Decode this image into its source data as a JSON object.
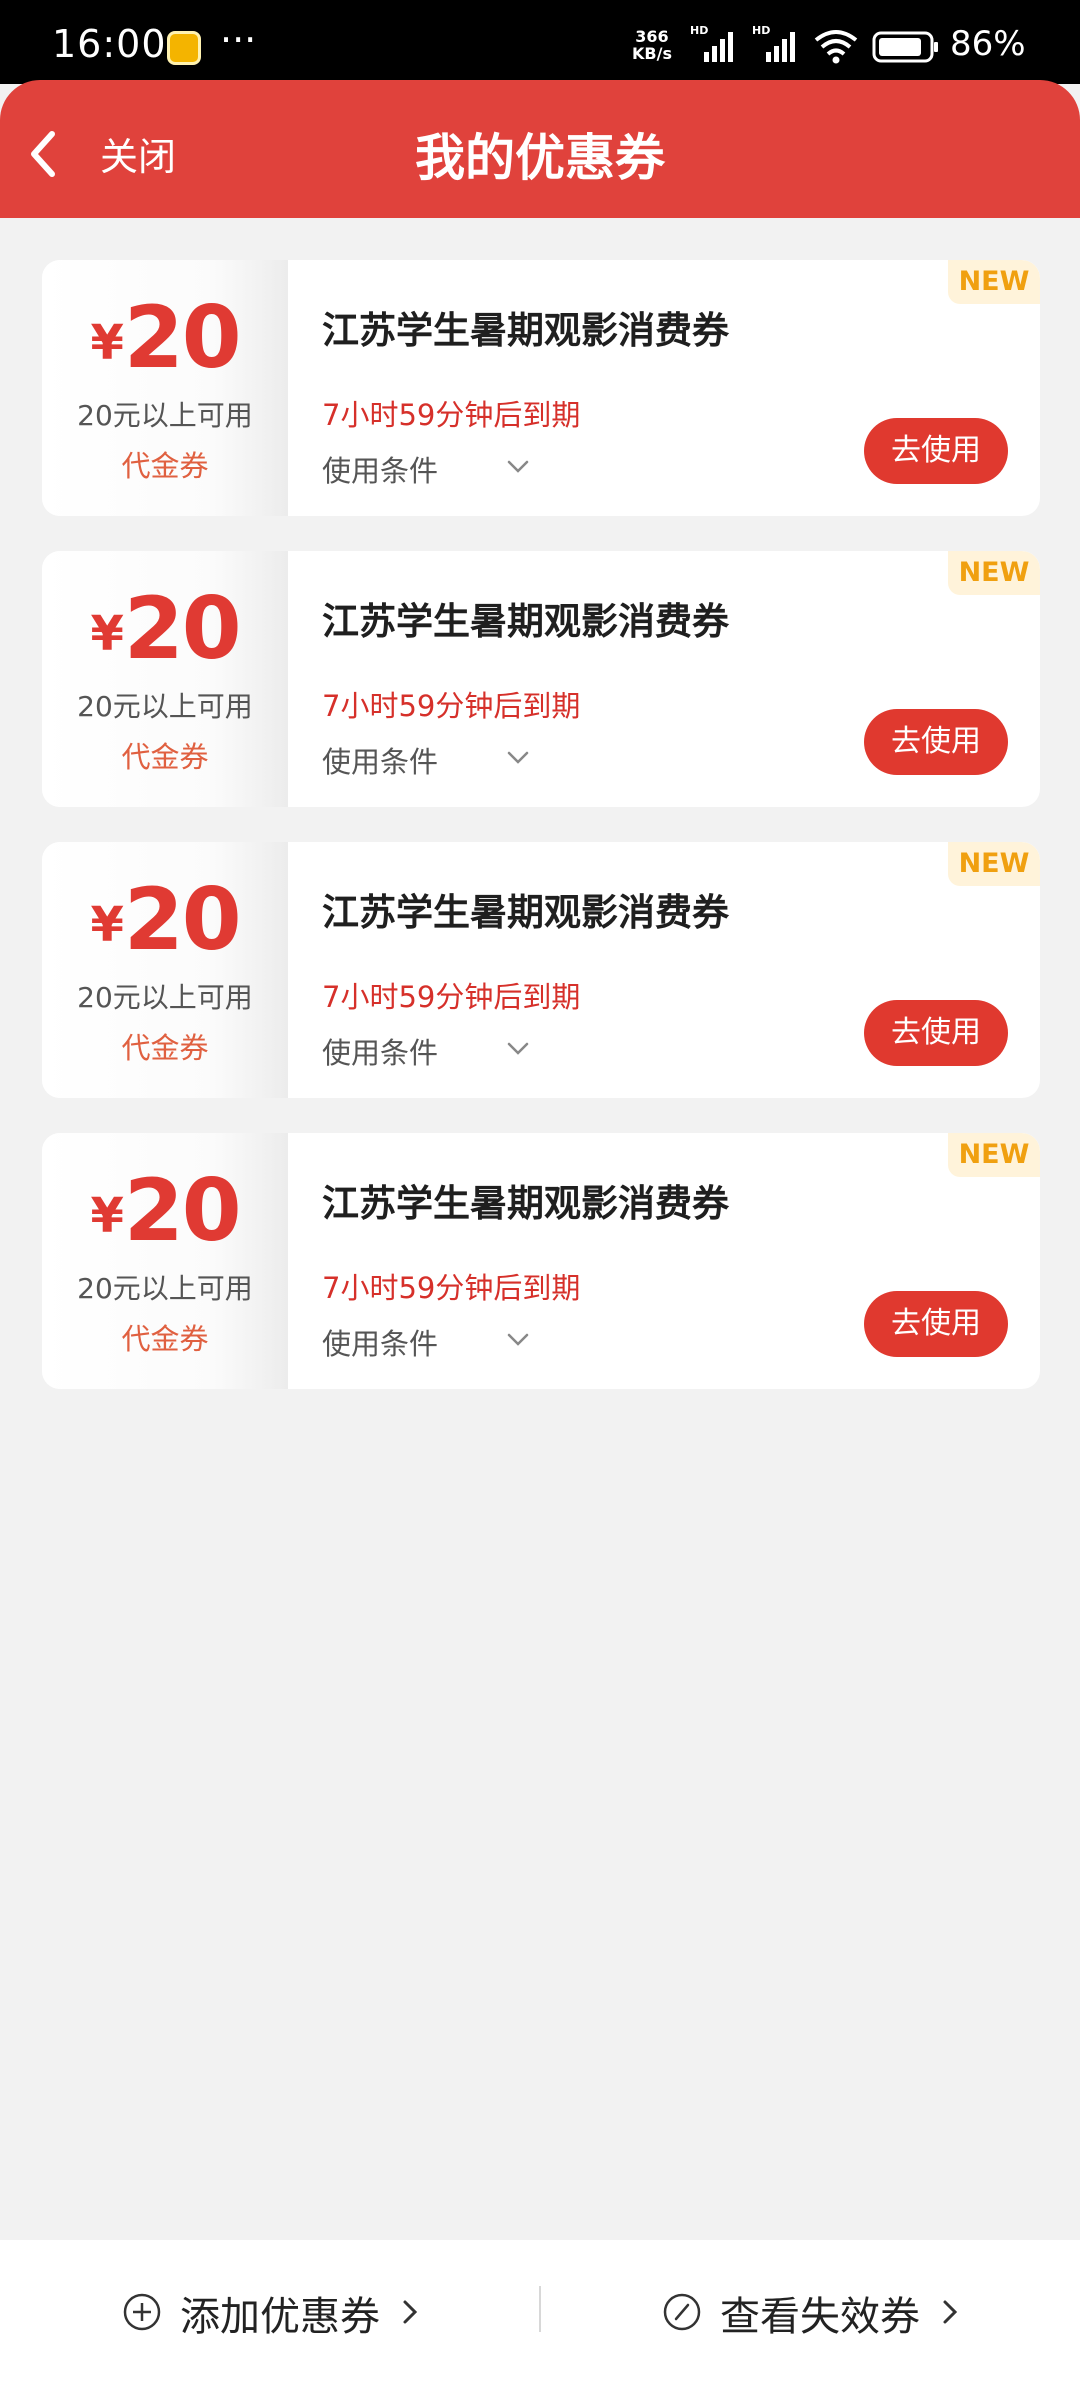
{
  "status_bar": {
    "time": "16:00",
    "more": "···",
    "net_speed_value": "366",
    "net_speed_unit": "KB/s",
    "signal_1": "HD",
    "signal_2": "HD",
    "battery": "86%"
  },
  "header": {
    "close_label": "关闭",
    "title": "我的优惠券",
    "background_color": "#e0423c"
  },
  "coupons": [
    {
      "currency": "¥",
      "amount": "20",
      "threshold": "20元以上可用",
      "type": "代金券",
      "name": "江苏学生暑期观影消费券",
      "expiry": "7小时59分钟后到期",
      "conditions": "使用条件",
      "badge": "NEW",
      "action": "去使用"
    },
    {
      "currency": "¥",
      "amount": "20",
      "threshold": "20元以上可用",
      "type": "代金券",
      "name": "江苏学生暑期观影消费券",
      "expiry": "7小时59分钟后到期",
      "conditions": "使用条件",
      "badge": "NEW",
      "action": "去使用"
    },
    {
      "currency": "¥",
      "amount": "20",
      "threshold": "20元以上可用",
      "type": "代金券",
      "name": "江苏学生暑期观影消费券",
      "expiry": "7小时59分钟后到期",
      "conditions": "使用条件",
      "badge": "NEW",
      "action": "去使用"
    },
    {
      "currency": "¥",
      "amount": "20",
      "threshold": "20元以上可用",
      "type": "代金券",
      "name": "江苏学生暑期观影消费券",
      "expiry": "7小时59分钟后到期",
      "conditions": "使用条件",
      "badge": "NEW",
      "action": "去使用"
    }
  ],
  "bottom_bar": {
    "add_label": "添加优惠券",
    "expired_label": "查看失效券"
  },
  "colors": {
    "accent_red": "#e0392f",
    "badge_orange": "#f0a010"
  },
  "icons": [
    "back-arrow-icon",
    "chevron-down-icon",
    "plus-circle-icon",
    "slash-circle-icon",
    "chevron-right-icon",
    "wifi-icon",
    "signal-icon",
    "battery-icon"
  ]
}
